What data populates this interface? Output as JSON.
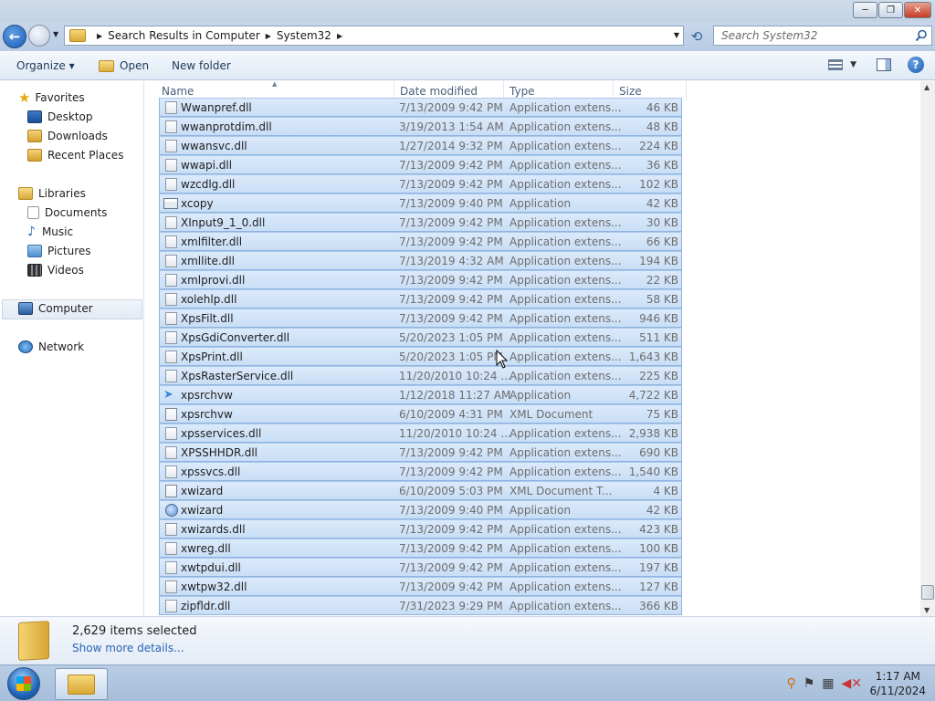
{
  "window": {
    "minimize": "─",
    "maximize": "❐",
    "close": "✕"
  },
  "address": {
    "crumbs": [
      "Search Results in Computer",
      "System32"
    ],
    "search_placeholder": "Search System32"
  },
  "toolbar": {
    "organize": "Organize ▾",
    "open": "Open",
    "new_folder": "New folder"
  },
  "nav": {
    "favorites": "Favorites",
    "desktop": "Desktop",
    "downloads": "Downloads",
    "recent_places": "Recent Places",
    "libraries": "Libraries",
    "documents": "Documents",
    "music": "Music",
    "pictures": "Pictures",
    "videos": "Videos",
    "computer": "Computer",
    "network": "Network"
  },
  "columns": {
    "name": "Name",
    "date": "Date modified",
    "type": "Type",
    "size": "Size"
  },
  "files": [
    {
      "name": "Wwanpref.dll",
      "date": "7/13/2009 9:42 PM",
      "type": "Application extens...",
      "size": "46 KB",
      "icon": "dll"
    },
    {
      "name": "wwanprotdim.dll",
      "date": "3/19/2013 1:54 AM",
      "type": "Application extens...",
      "size": "48 KB",
      "icon": "dll"
    },
    {
      "name": "wwansvc.dll",
      "date": "1/27/2014 9:32 PM",
      "type": "Application extens...",
      "size": "224 KB",
      "icon": "dll"
    },
    {
      "name": "wwapi.dll",
      "date": "7/13/2009 9:42 PM",
      "type": "Application extens...",
      "size": "36 KB",
      "icon": "dll"
    },
    {
      "name": "wzcdlg.dll",
      "date": "7/13/2009 9:42 PM",
      "type": "Application extens...",
      "size": "102 KB",
      "icon": "dll"
    },
    {
      "name": "xcopy",
      "date": "7/13/2009 9:40 PM",
      "type": "Application",
      "size": "42 KB",
      "icon": "app"
    },
    {
      "name": "XInput9_1_0.dll",
      "date": "7/13/2009 9:42 PM",
      "type": "Application extens...",
      "size": "30 KB",
      "icon": "dll"
    },
    {
      "name": "xmlfilter.dll",
      "date": "7/13/2009 9:42 PM",
      "type": "Application extens...",
      "size": "66 KB",
      "icon": "dll"
    },
    {
      "name": "xmllite.dll",
      "date": "7/13/2019 4:32 AM",
      "type": "Application extens...",
      "size": "194 KB",
      "icon": "dll"
    },
    {
      "name": "xmlprovi.dll",
      "date": "7/13/2009 9:42 PM",
      "type": "Application extens...",
      "size": "22 KB",
      "icon": "dll"
    },
    {
      "name": "xolehlp.dll",
      "date": "7/13/2009 9:42 PM",
      "type": "Application extens...",
      "size": "58 KB",
      "icon": "dll"
    },
    {
      "name": "XpsFilt.dll",
      "date": "7/13/2009 9:42 PM",
      "type": "Application extens...",
      "size": "946 KB",
      "icon": "dll"
    },
    {
      "name": "XpsGdiConverter.dll",
      "date": "5/20/2023 1:05 PM",
      "type": "Application extens...",
      "size": "511 KB",
      "icon": "dll"
    },
    {
      "name": "XpsPrint.dll",
      "date": "5/20/2023 1:05 PM",
      "type": "Application extens...",
      "size": "1,643 KB",
      "icon": "dll"
    },
    {
      "name": "XpsRasterService.dll",
      "date": "11/20/2010 10:24 ...",
      "type": "Application extens...",
      "size": "225 KB",
      "icon": "dll"
    },
    {
      "name": "xpsrchvw",
      "date": "1/12/2018 11:27 AM",
      "type": "Application",
      "size": "4,722 KB",
      "icon": "plane"
    },
    {
      "name": "xpsrchvw",
      "date": "6/10/2009 4:31 PM",
      "type": "XML Document",
      "size": "75 KB",
      "icon": "xml"
    },
    {
      "name": "xpsservices.dll",
      "date": "11/20/2010 10:24 ...",
      "type": "Application extens...",
      "size": "2,938 KB",
      "icon": "dll"
    },
    {
      "name": "XPSSHHDR.dll",
      "date": "7/13/2009 9:42 PM",
      "type": "Application extens...",
      "size": "690 KB",
      "icon": "dll"
    },
    {
      "name": "xpssvcs.dll",
      "date": "7/13/2009 9:42 PM",
      "type": "Application extens...",
      "size": "1,540 KB",
      "icon": "dll"
    },
    {
      "name": "xwizard",
      "date": "6/10/2009 5:03 PM",
      "type": "XML Document T...",
      "size": "4 KB",
      "icon": "xml"
    },
    {
      "name": "xwizard",
      "date": "7/13/2009 9:40 PM",
      "type": "Application",
      "size": "42 KB",
      "icon": "wiz"
    },
    {
      "name": "xwizards.dll",
      "date": "7/13/2009 9:42 PM",
      "type": "Application extens...",
      "size": "423 KB",
      "icon": "dll"
    },
    {
      "name": "xwreg.dll",
      "date": "7/13/2009 9:42 PM",
      "type": "Application extens...",
      "size": "100 KB",
      "icon": "dll"
    },
    {
      "name": "xwtpdui.dll",
      "date": "7/13/2009 9:42 PM",
      "type": "Application extens...",
      "size": "197 KB",
      "icon": "dll"
    },
    {
      "name": "xwtpw32.dll",
      "date": "7/13/2009 9:42 PM",
      "type": "Application extens...",
      "size": "127 KB",
      "icon": "dll"
    },
    {
      "name": "zipfldr.dll",
      "date": "7/31/2023 9:29 PM",
      "type": "Application extens...",
      "size": "366 KB",
      "icon": "dll"
    }
  ],
  "details": {
    "count": "2,629 items selected",
    "more": "Show more details..."
  },
  "clock": {
    "time": "1:17 AM",
    "date": "6/11/2024"
  }
}
